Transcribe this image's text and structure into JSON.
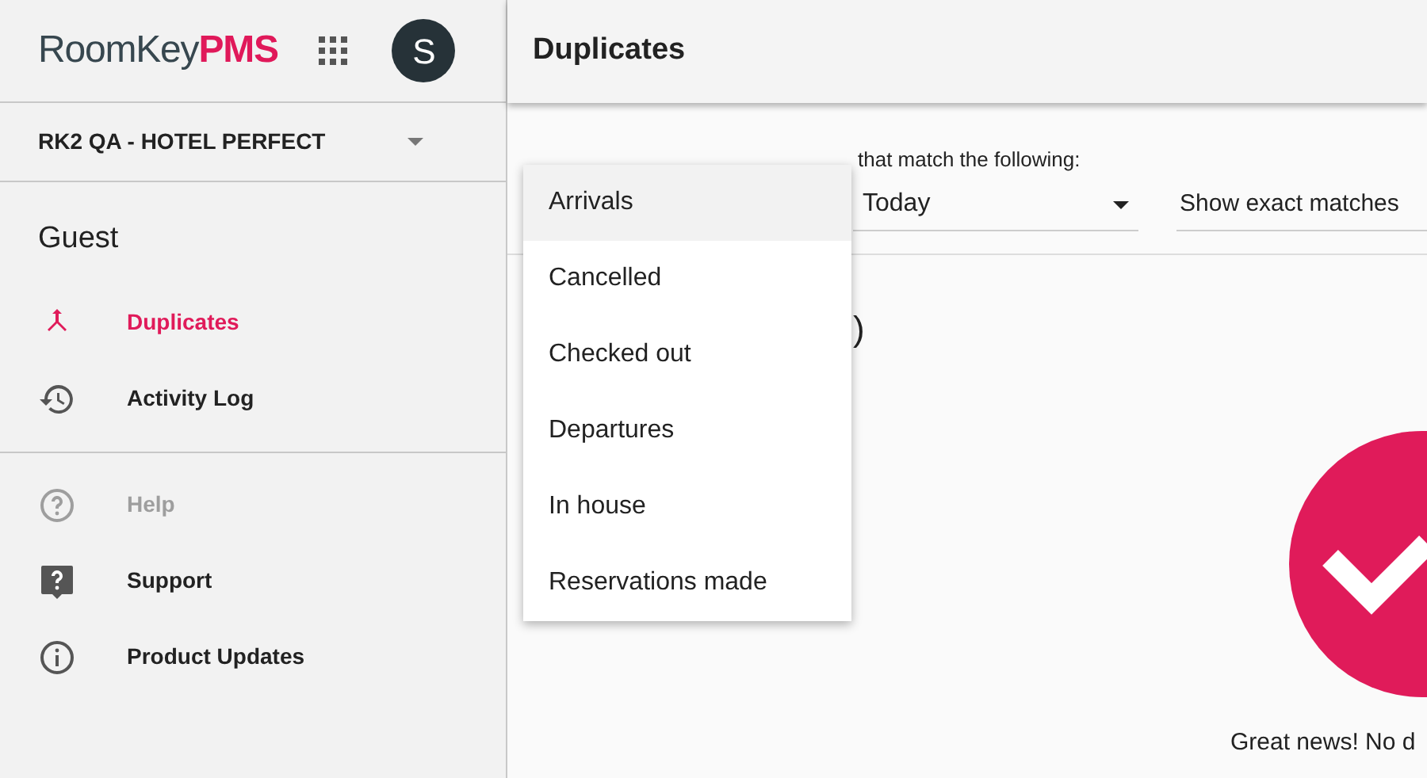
{
  "brand": {
    "name": "RoomKey",
    "suffix": "PMS"
  },
  "avatar": {
    "initial": "S"
  },
  "property": {
    "name": "RK2 QA - HOTEL PERFECT"
  },
  "sidebar": {
    "section": "Guest",
    "items": [
      {
        "label": "Duplicates",
        "kind": "merge",
        "selected": true,
        "disabled": false
      },
      {
        "label": "Activity Log",
        "kind": "history",
        "selected": false,
        "disabled": false
      }
    ],
    "help_items": [
      {
        "label": "Help",
        "kind": "help",
        "disabled": true
      },
      {
        "label": "Support",
        "kind": "support",
        "disabled": false
      },
      {
        "label": "Product Updates",
        "kind": "info",
        "disabled": false
      }
    ]
  },
  "page": {
    "title": "Duplicates"
  },
  "filters": {
    "label_visible": "that match the following:",
    "date": "Today",
    "match": "Show exact matches"
  },
  "results_heading_visible": ")",
  "menu": [
    {
      "label": "Arrivals",
      "selected": true
    },
    {
      "label": "Cancelled",
      "selected": false
    },
    {
      "label": "Checked out",
      "selected": false
    },
    {
      "label": "Departures",
      "selected": false
    },
    {
      "label": "In house",
      "selected": false
    },
    {
      "label": "Reservations made",
      "selected": false
    }
  ],
  "empty_state": {
    "message": "Great news! No d"
  }
}
